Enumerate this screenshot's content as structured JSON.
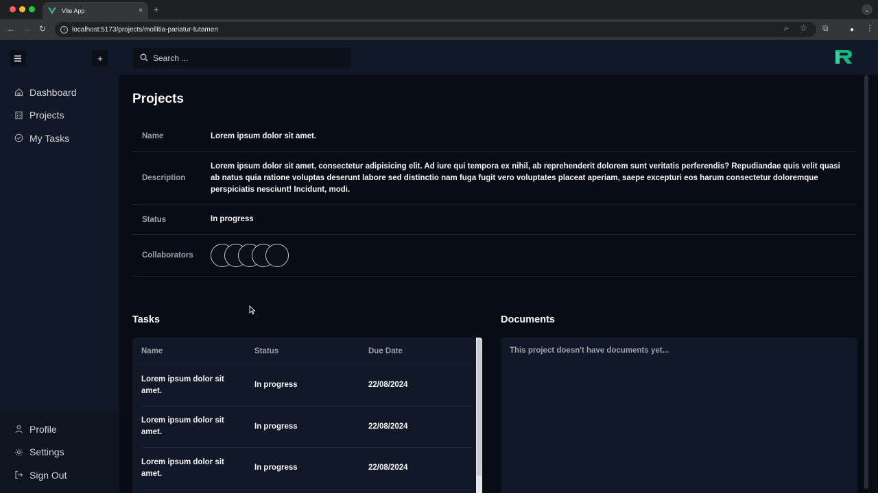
{
  "browser": {
    "tab_title": "Vite App",
    "tab_close": "×",
    "new_tab": "+",
    "url": "localhost:5173/projects/mollitia-pariatur-tutamen",
    "traffic_colors": [
      "#ff5f57",
      "#febc2e",
      "#28c840"
    ]
  },
  "sidebar": {
    "menu_icon": "hamburger-icon",
    "add_label": "+",
    "nav": [
      {
        "label": "Dashboard",
        "icon": "home-icon"
      },
      {
        "label": "Projects",
        "icon": "building-icon"
      },
      {
        "label": "My Tasks",
        "icon": "check-circle-icon"
      }
    ],
    "bottom": [
      {
        "label": "Profile",
        "icon": "user-icon"
      },
      {
        "label": "Settings",
        "icon": "gear-icon"
      },
      {
        "label": "Sign Out",
        "icon": "sign-out-icon"
      }
    ]
  },
  "topbar": {
    "search_placeholder": "Search ...",
    "brand_color": "#10b981"
  },
  "project": {
    "page_title": "Projects",
    "fields": {
      "name_label": "Name",
      "name_value": "Lorem ipsum dolor sit amet.",
      "description_label": "Description",
      "description_value": "Lorem ipsum dolor sit amet, consectetur adipisicing elit. Ad iure qui tempora ex nihil, ab reprehenderit dolorem sunt veritatis perferendis? Repudiandae quis velit quasi ab natus quia ratione voluptas deserunt labore sed distinctio nam fuga fugit vero voluptates placeat aperiam, saepe excepturi eos harum consectetur doloremque perspiciatis nesciunt! Incidunt, modi.",
      "status_label": "Status",
      "status_value": "In progress",
      "collaborators_label": "Collaborators"
    },
    "collaborator_count": 5
  },
  "tasks": {
    "title": "Tasks",
    "columns": [
      "Name",
      "Status",
      "Due Date"
    ],
    "rows": [
      {
        "name": "Lorem ipsum dolor sit amet.",
        "status": "In progress",
        "due": "22/08/2024"
      },
      {
        "name": "Lorem ipsum dolor sit amet.",
        "status": "In progress",
        "due": "22/08/2024"
      },
      {
        "name": "Lorem ipsum dolor sit amet.",
        "status": "In progress",
        "due": "22/08/2024"
      }
    ]
  },
  "documents": {
    "title": "Documents",
    "empty_message": "This project doesn't have documents yet..."
  }
}
